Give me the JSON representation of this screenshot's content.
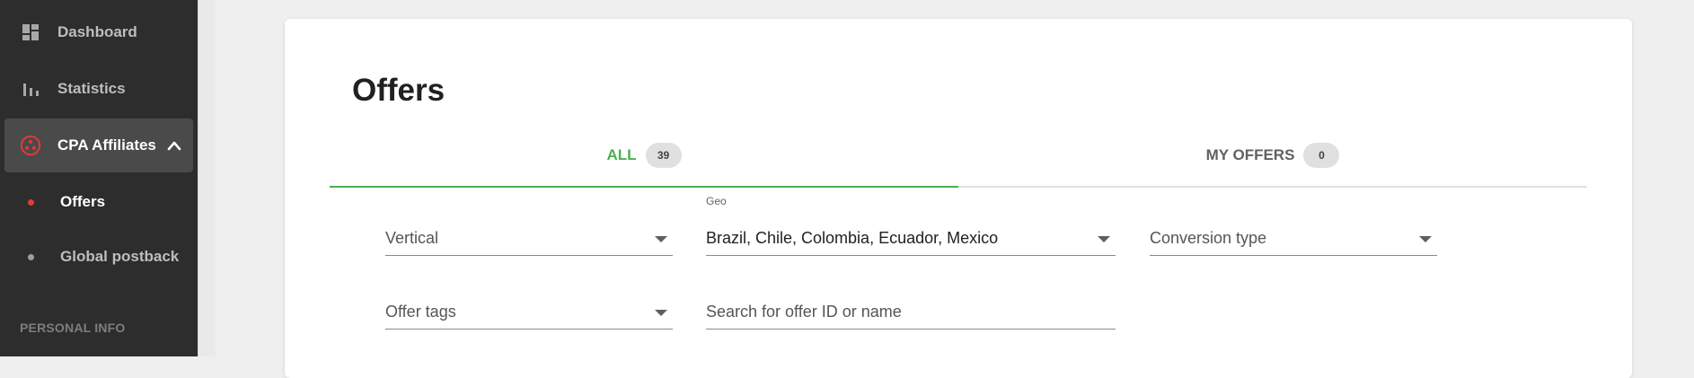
{
  "sidebar": {
    "items": [
      {
        "label": "Dashboard",
        "icon": "dashboard-icon"
      },
      {
        "label": "Statistics",
        "icon": "bar-chart-icon"
      },
      {
        "label": "CPA Affiliates",
        "icon": "affiliates-icon"
      }
    ],
    "subitems": [
      {
        "label": "Offers"
      },
      {
        "label": "Global postback"
      }
    ],
    "section_label": "PERSONAL INFO"
  },
  "main": {
    "title": "Offers",
    "tabs": [
      {
        "label": "ALL",
        "count": "39"
      },
      {
        "label": "MY OFFERS",
        "count": "0"
      }
    ],
    "filters": {
      "vertical": {
        "placeholder": "Vertical"
      },
      "geo": {
        "label": "Geo",
        "value": "Brazil, Chile, Colombia, Ecuador, Mexico"
      },
      "conversion": {
        "placeholder": "Conversion type"
      },
      "tags": {
        "placeholder": "Offer tags"
      },
      "search": {
        "placeholder": "Search for offer ID or name"
      }
    }
  },
  "colors": {
    "sidebar_bg": "#2d2d2d",
    "accent_green": "#4caf50",
    "accent_red": "#e53935"
  }
}
